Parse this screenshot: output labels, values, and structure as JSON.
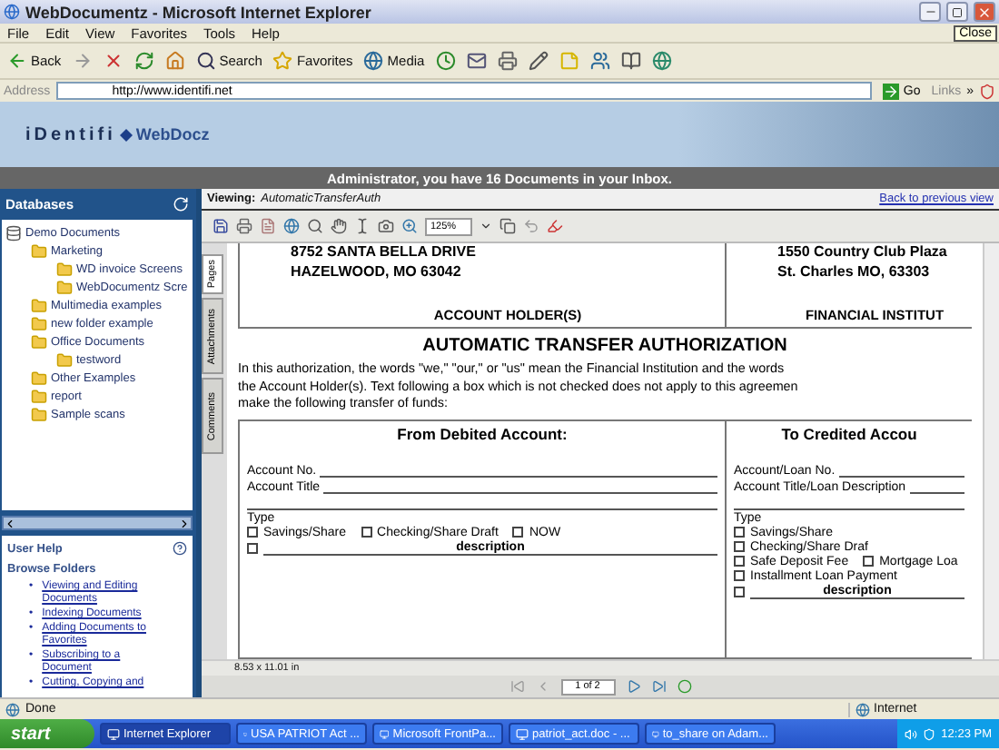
{
  "window": {
    "title": "WebDocumentz - Microsoft Internet Explorer",
    "tooltip": "Close"
  },
  "menu": [
    "File",
    "Edit",
    "View",
    "Favorites",
    "Tools",
    "Help"
  ],
  "toolbar": [
    {
      "kind": "back",
      "label": "Back"
    },
    {
      "kind": "forward"
    },
    {
      "kind": "stop"
    },
    {
      "kind": "refresh"
    },
    {
      "kind": "home"
    },
    {
      "kind": "search",
      "label": "Search"
    },
    {
      "kind": "favorites",
      "label": "Favorites"
    },
    {
      "kind": "media",
      "label": "Media"
    },
    {
      "kind": "history"
    },
    {
      "kind": "mail"
    },
    {
      "kind": "print"
    },
    {
      "kind": "edit"
    },
    {
      "kind": "note"
    },
    {
      "kind": "messenger"
    },
    {
      "kind": "research"
    },
    {
      "kind": "globe"
    }
  ],
  "address": {
    "label": "Address",
    "value": "http://www.identifi.net",
    "go": "Go",
    "links": "Links",
    "more": "»"
  },
  "banner": {
    "logo": "iDentifi",
    "product": "WebDocz",
    "message": "Administrator, you have 16 Documents in your Inbox."
  },
  "databases": {
    "title": "Databases",
    "tree": [
      {
        "label": "Demo Documents",
        "kind": "database",
        "children": [
          {
            "label": "Marketing",
            "kind": "folder",
            "children": [
              {
                "label": "WD invoice Screens",
                "kind": "folder"
              },
              {
                "label": "WebDocumentz Scre",
                "kind": "folder"
              }
            ]
          },
          {
            "label": "Multimedia examples",
            "kind": "folder"
          },
          {
            "label": "new folder example",
            "kind": "folder"
          },
          {
            "label": "Office Documents",
            "kind": "folder",
            "children": [
              {
                "label": "testword",
                "kind": "folder"
              }
            ]
          },
          {
            "label": "Other Examples",
            "kind": "folder"
          },
          {
            "label": "report",
            "kind": "folder"
          },
          {
            "label": "Sample scans",
            "kind": "folder"
          }
        ]
      }
    ]
  },
  "help": {
    "title": "User Help",
    "section": "Browse Folders",
    "marker": "•",
    "links": [
      "Viewing and Editing Documents",
      "Indexing Documents",
      "Adding Documents to Favorites",
      "Subscribing to a Document",
      "Cutting, Copying and"
    ]
  },
  "viewer": {
    "viewing_label": "Viewing:",
    "document_name": "AutomaticTransferAuth",
    "back_link": "Back to previous view",
    "zoom": "125%",
    "side_tabs": [
      {
        "label": "Pages",
        "selected": true
      },
      {
        "label": "Attachments",
        "selected": false
      },
      {
        "label": "Comments",
        "selected": false
      }
    ],
    "page_size": "8.53 x 11.01 in",
    "page": "1 of 2"
  },
  "document": {
    "holder_lines": [
      "8752 SANTA BELLA DRIVE",
      "HAZELWOOD, MO  63042"
    ],
    "institution_lines": [
      "1550 Country Club Plaza",
      "St. Charles MO, 63303"
    ],
    "holder_caption": "ACCOUNT HOLDER(S)",
    "institution_caption": "FINANCIAL INSTITUT",
    "title": "AUTOMATIC TRANSFER AUTHORIZATION",
    "intro_lines": [
      "In this authorization, the words \"we,\" \"our,\" or \"us\" mean the Financial Institution and the words",
      "the Account Holder(s). Text following a box which is not checked does not apply to this agreemen",
      "make the following transfer of funds:"
    ],
    "from": {
      "heading": "From Debited Account:",
      "fields": [
        "Account No.",
        "Account Title"
      ],
      "type_label": "Type",
      "options": [
        {
          "label": "Savings/Share",
          "checked": false
        },
        {
          "label": "Checking/Share Draft",
          "checked": false
        },
        {
          "label": "NOW",
          "checked": false
        },
        {
          "label": "description",
          "checked": false,
          "kind": "blank"
        }
      ]
    },
    "to": {
      "heading": "To Credited Accou",
      "fields": [
        "Account/Loan No.",
        "Account Title/Loan Description"
      ],
      "type_label": "Type",
      "options": [
        {
          "label": "Savings/Share",
          "checked": false
        },
        {
          "label": "Checking/Share Draf",
          "checked": false
        },
        {
          "label": "Safe Deposit Fee",
          "checked": false
        },
        {
          "label": "Mortgage Loa",
          "checked": false
        },
        {
          "label": "Installment Loan Payment",
          "checked": false
        },
        {
          "label": "description",
          "checked": false,
          "kind": "blank"
        }
      ]
    }
  },
  "status": {
    "text": "Done",
    "zone": "Internet"
  },
  "taskbar": {
    "start": "start",
    "tasks": [
      {
        "label": "Internet Explorer",
        "selected": true
      },
      {
        "label": "USA PATRIOT Act ...",
        "selected": false
      },
      {
        "label": "Microsoft FrontPa...",
        "selected": false
      },
      {
        "label": "patriot_act.doc - ...",
        "selected": false
      },
      {
        "label": "to_share on Adam...",
        "selected": false
      }
    ],
    "clock": "12:23 PM"
  }
}
